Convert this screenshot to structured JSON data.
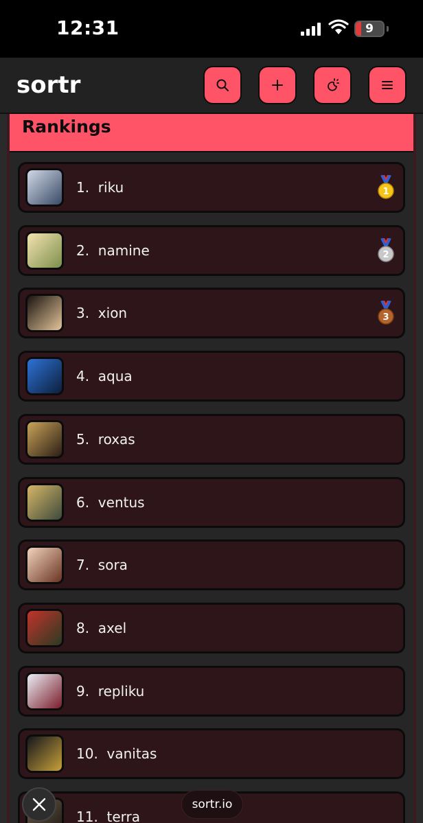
{
  "status": {
    "time": "12:31",
    "battery": "9"
  },
  "header": {
    "logo": "sortr",
    "buttons": [
      {
        "icon": "search-icon"
      },
      {
        "icon": "plus-icon"
      },
      {
        "icon": "theme-icon"
      },
      {
        "icon": "menu-icon"
      }
    ]
  },
  "rankings": {
    "title": "Rankings",
    "items": [
      {
        "label": "1.  riku",
        "medal": "gold",
        "medal_number": "1",
        "thumb_colors": [
          "#cfd8e6",
          "#3a4a66"
        ]
      },
      {
        "label": "2.  namine",
        "medal": "silver",
        "medal_number": "2",
        "thumb_colors": [
          "#f4e3b0",
          "#7c8f4c"
        ]
      },
      {
        "label": "3.  xion",
        "medal": "bronze",
        "medal_number": "3",
        "thumb_colors": [
          "#1b1410",
          "#e3c59a"
        ]
      },
      {
        "label": "4.  aqua",
        "medal": "",
        "thumb_colors": [
          "#2e72d6",
          "#0d1f3c"
        ]
      },
      {
        "label": "5.  roxas",
        "medal": "",
        "thumb_colors": [
          "#c9a35a",
          "#2b1e14"
        ]
      },
      {
        "label": "6.  ventus",
        "medal": "",
        "thumb_colors": [
          "#d7b667",
          "#3d4a3c"
        ]
      },
      {
        "label": "7.  sora",
        "medal": "",
        "thumb_colors": [
          "#f1d3bd",
          "#6a3424"
        ]
      },
      {
        "label": "8.  axel",
        "medal": "",
        "thumb_colors": [
          "#c2332b",
          "#2a3b22"
        ]
      },
      {
        "label": "9.  repliku",
        "medal": "",
        "thumb_colors": [
          "#e9eef4",
          "#7a1c2a"
        ]
      },
      {
        "label": "10.  vanitas",
        "medal": "",
        "thumb_colors": [
          "#14161c",
          "#c9a13a"
        ]
      },
      {
        "label": "11.  terra",
        "medal": "",
        "thumb_colors": [
          "#6b5a44",
          "#1e1a16"
        ]
      }
    ]
  },
  "footer": {
    "site": "sortr.io"
  },
  "colors": {
    "accent": "#ff5468",
    "card": "#2e1519",
    "header": "#222222"
  }
}
